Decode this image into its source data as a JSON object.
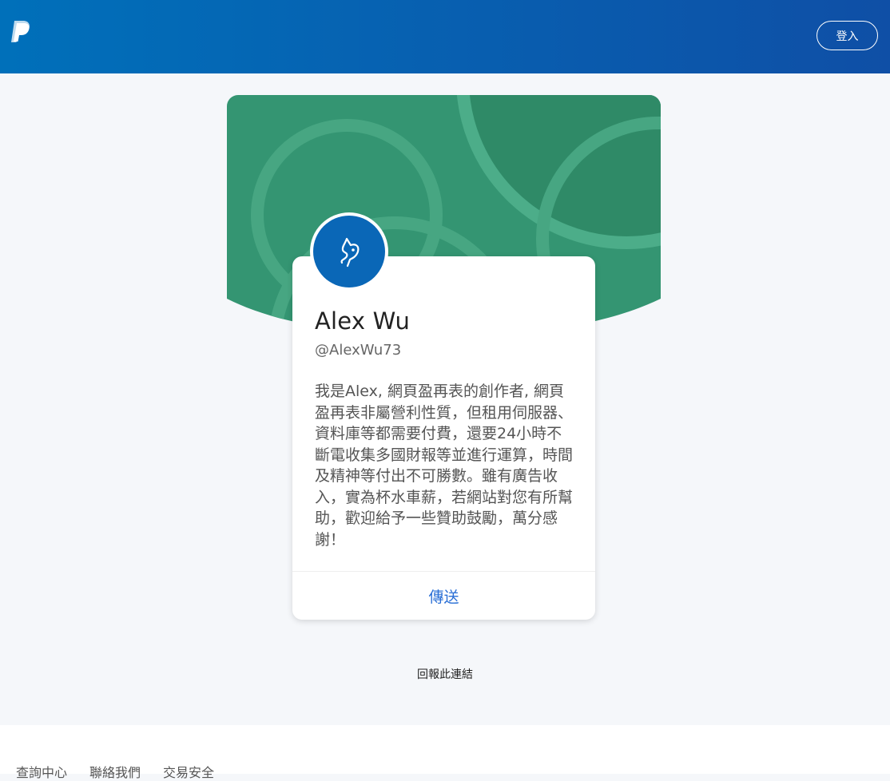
{
  "header": {
    "logo_icon": "paypal-logo-icon",
    "login_label": "登入"
  },
  "profile": {
    "name": "Alex Wu",
    "handle": "@AlexWu73",
    "bio": "我是Alex, 網頁盈再表的創作者, 網頁盈再表非屬營利性質，但租用伺服器、資料庫等都需要付費，還要24小時不斷電收集多國財報等並進行運算，時間及精神等付出不可勝數。雖有廣告收入，實為杯水車薪，若網站對您有所幫助，歡迎給予一些贊助鼓勵，萬分感謝！",
    "avatar_icon": "profile-avatar-icon",
    "send_label": "傳送"
  },
  "report_link": "回報此連結",
  "footer": {
    "links": [
      "查詢中心",
      "聯絡我們",
      "交易安全"
    ]
  },
  "colors": {
    "header": "#0070ba",
    "banner": "#34946f",
    "avatar": "#0a67b7",
    "link": "#2a6fd6"
  }
}
